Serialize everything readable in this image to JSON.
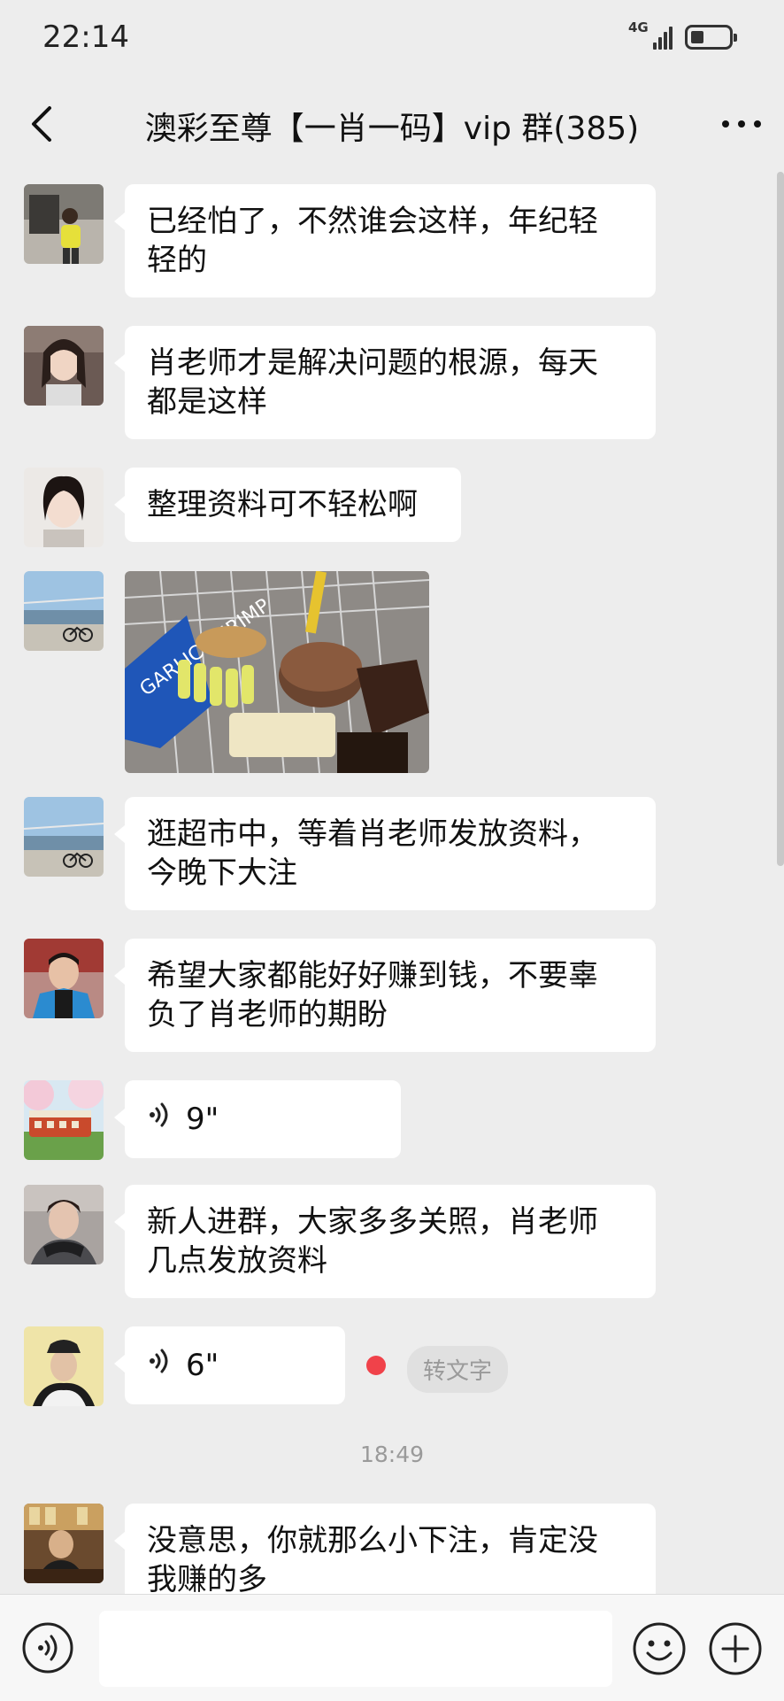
{
  "status_bar": {
    "time": "22:14",
    "network": "4G"
  },
  "header": {
    "title": "澳彩至尊【一肖一码】vip 群(385)"
  },
  "messages": [
    {
      "type": "text",
      "lines": [
        "已经怕了，不然谁会这样，年纪轻",
        "轻的"
      ]
    },
    {
      "type": "text",
      "lines": [
        "肖老师才是解决问题的根源，每天",
        "都是这样"
      ]
    },
    {
      "type": "text",
      "lines": [
        "整理资料可不轻松啊"
      ]
    },
    {
      "type": "image",
      "label": "GARLIC SHRIMP"
    },
    {
      "type": "text",
      "lines": [
        "逛超市中，等着肖老师发放资料，",
        "今晚下大注"
      ]
    },
    {
      "type": "text",
      "lines": [
        "希望大家都能好好赚到钱，不要辜",
        "负了肖老师的期盼"
      ]
    },
    {
      "type": "voice",
      "duration": "9\""
    },
    {
      "type": "text",
      "lines": [
        "新人进群，大家多多关照，肖老师",
        "几点发放资料"
      ]
    },
    {
      "type": "voice",
      "duration": "6\"",
      "convert_label": "转文字"
    },
    {
      "type": "text",
      "lines": [
        "没意思，你就那么小下注，肯定没",
        "我赚的多"
      ]
    }
  ],
  "time_separator": "18:49",
  "colors": {
    "background": "#ededed",
    "bubble": "#ffffff",
    "unread_dot": "#f0424a"
  },
  "input_bar": {
    "placeholder": ""
  },
  "icons": [
    "back-arrow-icon",
    "more-icon",
    "voice-input-icon",
    "emoji-icon",
    "plus-icon"
  ]
}
